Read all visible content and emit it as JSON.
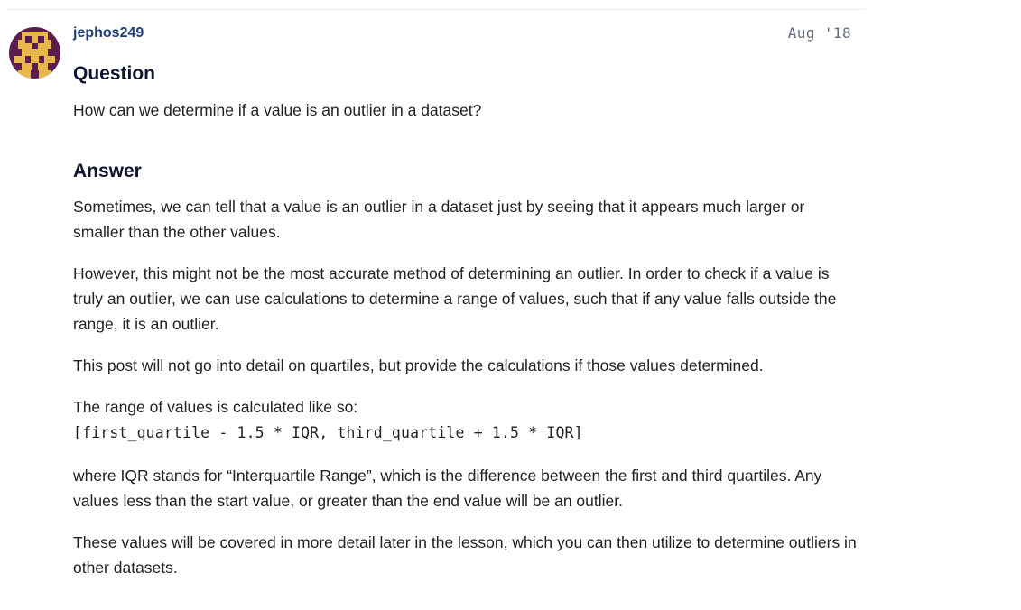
{
  "post": {
    "username": "jephos249",
    "date": "Aug '18",
    "question_heading": "Question",
    "question_text": "How can we determine if a value is an outlier in a dataset?",
    "answer_heading": "Answer",
    "paragraphs": [
      "Sometimes, we can tell that a value is an outlier in a dataset just by seeing that it appears much larger or smaller than the other values.",
      "However, this might not be the most accurate method of determining an outlier. In order to check if a value is truly an outlier, we can use calculations to determine a range of values, such that if any value falls outside the range, it is an outlier.",
      "This post will not go into detail on quartiles, but provide the calculations if those values determined.",
      "The range of values is calculated like so:",
      "where IQR stands for “Interquartile Range”, which is the difference between the first and third quartiles. Any values less than the start value, or greater than the end value will be an outlier.",
      "These values will be covered in more detail later in the lesson, which you can then utilize to determine outliers in other datasets."
    ],
    "code": "[first_quartile - 1.5 * IQR, third_quartile + 1.5 * IQR]"
  },
  "colors": {
    "username": "#1f3e73",
    "date": "#646b80",
    "avatar_bg": "#5b1d4f",
    "avatar_fg": "#e8b84a"
  },
  "icons": {
    "avatar": "pixel-art-avatar"
  }
}
